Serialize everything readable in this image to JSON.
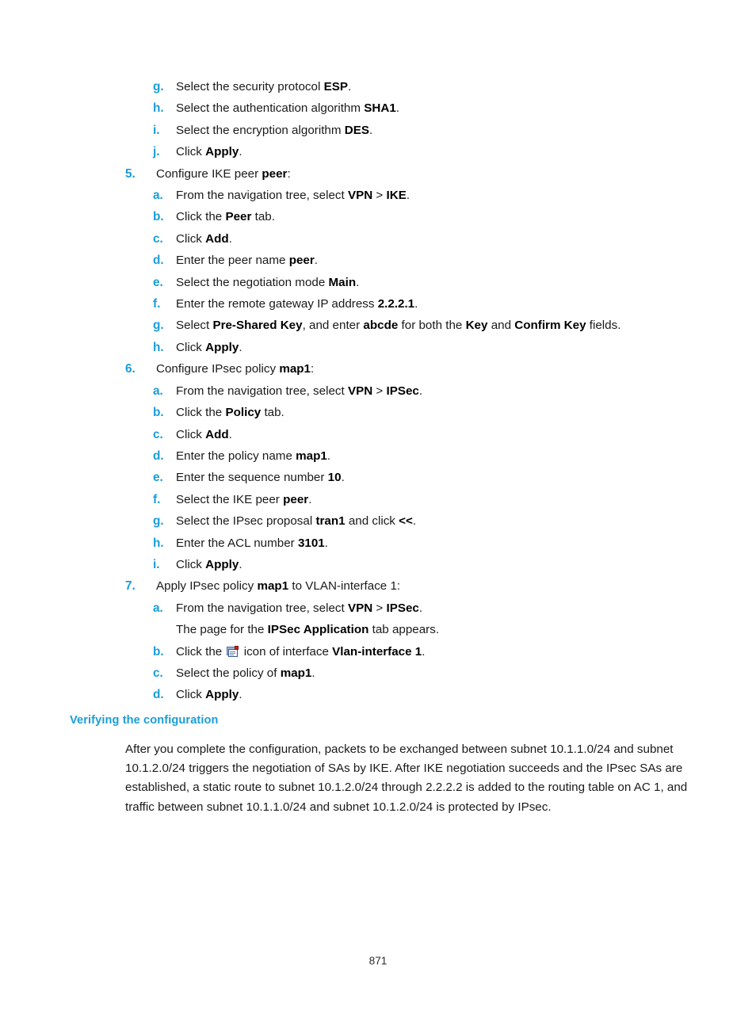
{
  "page": {
    "number": "871"
  },
  "steps": [
    {
      "level": 2,
      "marker": "g.",
      "parts": [
        {
          "text": "Select the security protocol ",
          "bold": false
        },
        {
          "text": "ESP",
          "bold": true
        },
        {
          "text": ".",
          "bold": false
        }
      ]
    },
    {
      "level": 2,
      "marker": "h.",
      "parts": [
        {
          "text": "Select the authentication algorithm ",
          "bold": false
        },
        {
          "text": "SHA1",
          "bold": true
        },
        {
          "text": ".",
          "bold": false
        }
      ]
    },
    {
      "level": 2,
      "marker": "i.",
      "parts": [
        {
          "text": "Select the encryption algorithm ",
          "bold": false
        },
        {
          "text": "DES",
          "bold": true
        },
        {
          "text": ".",
          "bold": false
        }
      ]
    },
    {
      "level": 2,
      "marker": "j.",
      "parts": [
        {
          "text": "Click ",
          "bold": false
        },
        {
          "text": "Apply",
          "bold": true
        },
        {
          "text": ".",
          "bold": false
        }
      ]
    },
    {
      "level": 1,
      "marker": "5.",
      "parts": [
        {
          "text": "Configure IKE peer ",
          "bold": false
        },
        {
          "text": "peer",
          "bold": true
        },
        {
          "text": ":",
          "bold": false
        }
      ]
    },
    {
      "level": 2,
      "marker": "a.",
      "parts": [
        {
          "text": "From the navigation tree, select ",
          "bold": false
        },
        {
          "text": "VPN",
          "bold": true
        },
        {
          "text": " > ",
          "bold": false
        },
        {
          "text": "IKE",
          "bold": true
        },
        {
          "text": ".",
          "bold": false
        }
      ]
    },
    {
      "level": 2,
      "marker": "b.",
      "parts": [
        {
          "text": "Click the ",
          "bold": false
        },
        {
          "text": "Peer",
          "bold": true
        },
        {
          "text": " tab.",
          "bold": false
        }
      ]
    },
    {
      "level": 2,
      "marker": "c.",
      "parts": [
        {
          "text": "Click ",
          "bold": false
        },
        {
          "text": "Add",
          "bold": true
        },
        {
          "text": ".",
          "bold": false
        }
      ]
    },
    {
      "level": 2,
      "marker": "d.",
      "parts": [
        {
          "text": "Enter the peer name ",
          "bold": false
        },
        {
          "text": "peer",
          "bold": true
        },
        {
          "text": ".",
          "bold": false
        }
      ]
    },
    {
      "level": 2,
      "marker": "e.",
      "parts": [
        {
          "text": "Select the negotiation mode ",
          "bold": false
        },
        {
          "text": "Main",
          "bold": true
        },
        {
          "text": ".",
          "bold": false
        }
      ]
    },
    {
      "level": 2,
      "marker": "f.",
      "parts": [
        {
          "text": "Enter the remote gateway IP address ",
          "bold": false
        },
        {
          "text": "2.2.2.1",
          "bold": true
        },
        {
          "text": ".",
          "bold": false
        }
      ]
    },
    {
      "level": 2,
      "marker": "g.",
      "parts": [
        {
          "text": "Select ",
          "bold": false
        },
        {
          "text": "Pre-Shared Key",
          "bold": true
        },
        {
          "text": ", and enter ",
          "bold": false
        },
        {
          "text": "abcde",
          "bold": true
        },
        {
          "text": " for both the ",
          "bold": false
        },
        {
          "text": "Key",
          "bold": true
        },
        {
          "text": " and ",
          "bold": false
        },
        {
          "text": "Confirm Key",
          "bold": true
        },
        {
          "text": " fields.",
          "bold": false
        }
      ]
    },
    {
      "level": 2,
      "marker": "h.",
      "parts": [
        {
          "text": "Click ",
          "bold": false
        },
        {
          "text": "Apply",
          "bold": true
        },
        {
          "text": ".",
          "bold": false
        }
      ]
    },
    {
      "level": 1,
      "marker": "6.",
      "parts": [
        {
          "text": "Configure IPsec policy ",
          "bold": false
        },
        {
          "text": "map1",
          "bold": true
        },
        {
          "text": ":",
          "bold": false
        }
      ]
    },
    {
      "level": 2,
      "marker": "a.",
      "parts": [
        {
          "text": "From the navigation tree, select ",
          "bold": false
        },
        {
          "text": "VPN",
          "bold": true
        },
        {
          "text": " > ",
          "bold": false
        },
        {
          "text": "IPSec",
          "bold": true
        },
        {
          "text": ".",
          "bold": false
        }
      ]
    },
    {
      "level": 2,
      "marker": "b.",
      "parts": [
        {
          "text": "Click the ",
          "bold": false
        },
        {
          "text": "Policy",
          "bold": true
        },
        {
          "text": " tab.",
          "bold": false
        }
      ]
    },
    {
      "level": 2,
      "marker": "c.",
      "parts": [
        {
          "text": "Click ",
          "bold": false
        },
        {
          "text": "Add",
          "bold": true
        },
        {
          "text": ".",
          "bold": false
        }
      ]
    },
    {
      "level": 2,
      "marker": "d.",
      "parts": [
        {
          "text": "Enter the policy name ",
          "bold": false
        },
        {
          "text": "map1",
          "bold": true
        },
        {
          "text": ".",
          "bold": false
        }
      ]
    },
    {
      "level": 2,
      "marker": "e.",
      "parts": [
        {
          "text": "Enter the sequence number ",
          "bold": false
        },
        {
          "text": "10",
          "bold": true
        },
        {
          "text": ".",
          "bold": false
        }
      ]
    },
    {
      "level": 2,
      "marker": "f.",
      "parts": [
        {
          "text": "Select the IKE peer ",
          "bold": false
        },
        {
          "text": "peer",
          "bold": true
        },
        {
          "text": ".",
          "bold": false
        }
      ]
    },
    {
      "level": 2,
      "marker": "g.",
      "parts": [
        {
          "text": "Select the IPsec proposal ",
          "bold": false
        },
        {
          "text": "tran1",
          "bold": true
        },
        {
          "text": " and click ",
          "bold": false
        },
        {
          "text": "<<",
          "bold": true
        },
        {
          "text": ".",
          "bold": false
        }
      ]
    },
    {
      "level": 2,
      "marker": "h.",
      "parts": [
        {
          "text": "Enter the ACL number ",
          "bold": false
        },
        {
          "text": "3101",
          "bold": true
        },
        {
          "text": ".",
          "bold": false
        }
      ]
    },
    {
      "level": 2,
      "marker": "i.",
      "parts": [
        {
          "text": "Click ",
          "bold": false
        },
        {
          "text": "Apply",
          "bold": true
        },
        {
          "text": ".",
          "bold": false
        }
      ]
    },
    {
      "level": 1,
      "marker": "7.",
      "parts": [
        {
          "text": "Apply IPsec policy ",
          "bold": false
        },
        {
          "text": "map1",
          "bold": true
        },
        {
          "text": " to VLAN-interface 1:",
          "bold": false
        }
      ]
    },
    {
      "level": 2,
      "marker": "a.",
      "parts": [
        {
          "text": "From the navigation tree, select ",
          "bold": false
        },
        {
          "text": "VPN",
          "bold": true
        },
        {
          "text": " > ",
          "bold": false
        },
        {
          "text": "IPSec",
          "bold": true
        },
        {
          "text": ".",
          "bold": false
        }
      ]
    },
    {
      "level": 0,
      "continuation": true,
      "parts": [
        {
          "text": "The page for the ",
          "bold": false
        },
        {
          "text": "IPSec Application",
          "bold": true
        },
        {
          "text": " tab appears.",
          "bold": false
        }
      ]
    },
    {
      "level": 2,
      "marker": "b.",
      "parts": [
        {
          "text": "Click the ",
          "bold": false
        },
        {
          "icon": "ipsec-policy-apply-icon"
        },
        {
          "text": " icon of interface ",
          "bold": false
        },
        {
          "text": "Vlan-interface 1",
          "bold": true
        },
        {
          "text": ".",
          "bold": false
        }
      ]
    },
    {
      "level": 2,
      "marker": "c.",
      "parts": [
        {
          "text": "Select the policy of ",
          "bold": false
        },
        {
          "text": "map1",
          "bold": true
        },
        {
          "text": ".",
          "bold": false
        }
      ]
    },
    {
      "level": 2,
      "marker": "d.",
      "parts": [
        {
          "text": "Click ",
          "bold": false
        },
        {
          "text": "Apply",
          "bold": true
        },
        {
          "text": ".",
          "bold": false
        }
      ]
    }
  ],
  "verify_section": {
    "heading": "Verifying the configuration",
    "paragraph": "After you complete the configuration, packets to be exchanged between subnet 10.1.1.0/24 and subnet 10.1.2.0/24 triggers the negotiation of SAs by IKE. After IKE negotiation succeeds and the IPsec SAs are established, a static route to subnet 10.1.2.0/24 through 2.2.2.2 is added to the routing table on AC 1, and traffic between subnet 10.1.1.0/24 and subnet 10.1.2.0/24 is protected by IPsec."
  },
  "colors": {
    "accent_blue": "#1b9dd9",
    "body_text": "#1a1a1a",
    "icon_red": "#d81f1f",
    "page_background": "#ffffff"
  }
}
